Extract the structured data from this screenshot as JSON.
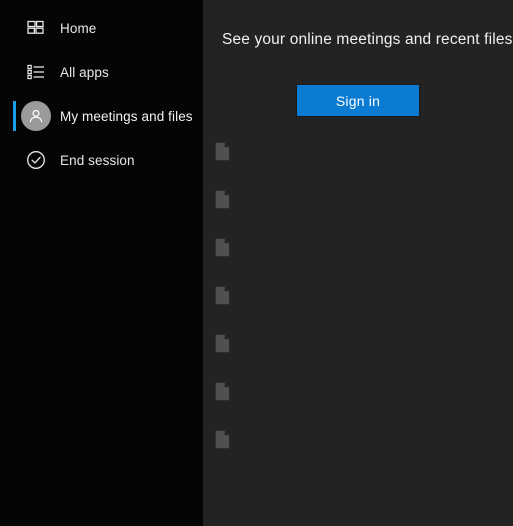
{
  "theme": {
    "sidebar_bg": "#050505",
    "main_bg": "#232323",
    "accent_blue": "#1b9fe8",
    "button_blue": "#0a7bd1",
    "text_primary": "#f0f0f0",
    "skeleton_long": "#4e4e4e",
    "skeleton_short": "#3f3f3f",
    "avatar_bg": "#9b9b9b"
  },
  "sidebar": {
    "items": [
      {
        "label": "Home",
        "icon": "grid-icon",
        "selected": false
      },
      {
        "label": "All apps",
        "icon": "list-icon",
        "selected": false
      },
      {
        "label": "My meetings and files",
        "icon": "avatar-icon",
        "selected": true
      },
      {
        "label": "End session",
        "icon": "check-circle-icon",
        "selected": false
      }
    ]
  },
  "main": {
    "headline": "See your online meetings and recent files",
    "sign_in_label": "Sign in",
    "skeleton_rows": [
      {
        "icon": "document-icon"
      },
      {
        "icon": "document-icon"
      },
      {
        "icon": "document-icon"
      },
      {
        "icon": "document-icon"
      },
      {
        "icon": "document-icon"
      },
      {
        "icon": "document-icon"
      },
      {
        "icon": "document-icon"
      }
    ]
  }
}
